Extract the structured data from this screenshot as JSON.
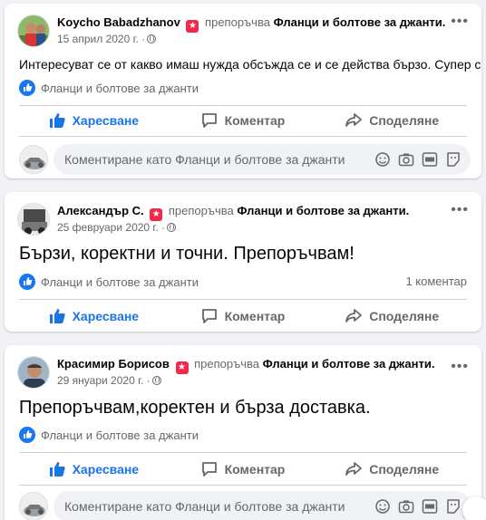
{
  "posts": [
    {
      "author": "Koycho Babadzhanov",
      "recommends": "препоръчва",
      "page": "Фланци и болтове за джанти.",
      "date": "15 април 2020 г. ·",
      "text": "Интересуват се от какво имаш нужда обсъжда се и се действа бързо. Супер са.",
      "tag": "Фланци и болтове за джанти",
      "comments": "",
      "like_label": "Харесване",
      "comment_label": "Коментар",
      "share_label": "Споделяне",
      "comment_placeholder": "Коментиране като Фланци и болтове за джанти"
    },
    {
      "author": "Александър С.",
      "recommends": "препоръчва",
      "page": "Фланци и болтове за джанти.",
      "date": "25 февруари 2020 г. ·",
      "text": "Бързи, коректни и точни. Препоръчвам!",
      "tag": "Фланци и болтове за джанти",
      "comments": "1 коментар",
      "like_label": "Харесване",
      "comment_label": "Коментар",
      "share_label": "Споделяне"
    },
    {
      "author": "Красимир Борисов",
      "recommends": "препоръчва",
      "page": "Фланци и болтове за джанти.",
      "date": "29 януари 2020 г. ·",
      "text": "Препоръчвам,коректен и бърза доставка.",
      "tag": "Фланци и болтове за джанти",
      "comments": "",
      "like_label": "Харесване",
      "comment_label": "Коментар",
      "share_label": "Споделяне",
      "comment_placeholder": "Коментиране като Фланци и болтове за джанти"
    }
  ],
  "colors": {
    "accent": "#1b74e4",
    "badge": "#f02849",
    "muted": "#65676b",
    "background": "#f0f2f5"
  },
  "icons": [
    "recommend-star-icon",
    "globe-icon",
    "more-icon",
    "thumbs-up-icon",
    "comment-icon",
    "share-icon",
    "emoji-icon",
    "camera-icon",
    "gif-icon",
    "sticker-icon"
  ]
}
